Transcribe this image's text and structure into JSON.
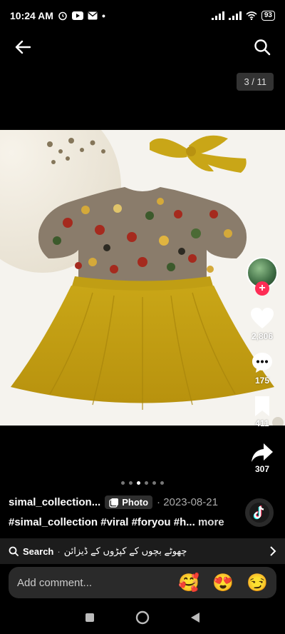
{
  "status_bar": {
    "time": "10:24 AM",
    "battery": "93"
  },
  "media": {
    "page_counter": "3 / 11",
    "dots_count": 6,
    "active_dot": 3
  },
  "engagement": {
    "likes": "2,806",
    "comments": "175",
    "saves": "411",
    "shares": "307"
  },
  "post": {
    "username": "simal_collection...",
    "type_badge": "Photo",
    "date": "· 2023-08-21",
    "hashtags": "#simal_collection #viral #foryou #h...",
    "more_label": "more"
  },
  "search_suggestion": {
    "label": "Search",
    "separator": "·",
    "query": "چھوٹے بچوں کے کپڑوں کے ڈیزائن"
  },
  "comment_input": {
    "placeholder": "Add comment...",
    "emojis": [
      "🥰",
      "😍",
      "😏"
    ]
  },
  "colors": {
    "accent": "#fe2c55",
    "dress_yellow": "#c8a51a"
  }
}
